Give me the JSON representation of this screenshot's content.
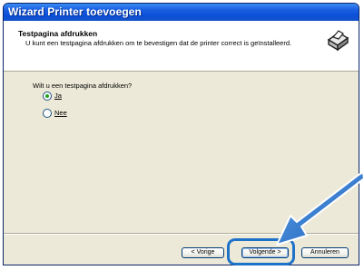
{
  "window": {
    "title": "Wizard Printer toevoegen"
  },
  "header": {
    "title": "Testpagina afdrukken",
    "description": "U kunt een testpagina afdrukken om te bevestigen dat de printer correct is geïnstalleerd."
  },
  "icons": {
    "header_icon": "printer-icon",
    "callout": "arrow-icon"
  },
  "main": {
    "question": "Wilt u een testpagina afdrukken?",
    "options": [
      {
        "label": "Ja",
        "selected": true
      },
      {
        "label": "Nee",
        "selected": false
      }
    ]
  },
  "buttons": {
    "prev": "< Vorige",
    "next": "Volgende >",
    "cancel": "Annuleren"
  },
  "colors": {
    "titlebar": "#0a4fd8",
    "dialog_bg": "#ece9d8",
    "highlight": "#1e73c8",
    "radio_selected": "#21a121"
  }
}
